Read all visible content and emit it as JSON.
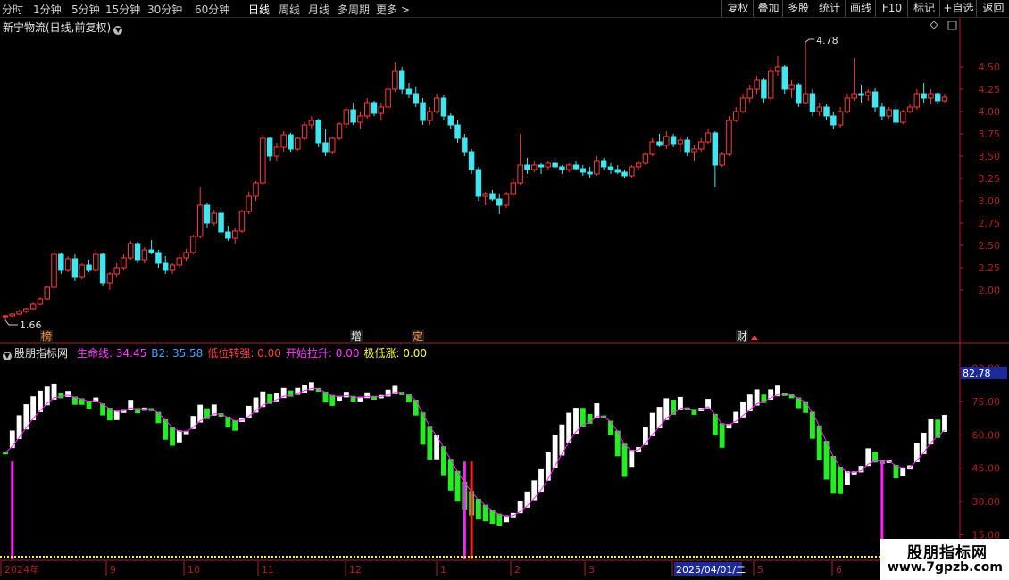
{
  "toolbar": {
    "tabs": [
      "分时",
      "1分钟",
      "5分钟",
      "15分钟",
      "30分钟",
      "60分钟",
      "日线",
      "周线",
      "月线",
      "多周期",
      "更多 >"
    ],
    "active": "日线",
    "right_buttons": [
      "复权",
      "叠加",
      "多股",
      "统计",
      "画线",
      "F10",
      "标记",
      "+自选",
      "返回"
    ]
  },
  "main_chart": {
    "title": "新宁物流(日线,前复权)",
    "price_ticks": [
      "4.50",
      "4.25",
      "4.00",
      "3.75",
      "3.50",
      "3.25",
      "3.00",
      "2.75",
      "2.50",
      "2.25",
      "2.00"
    ],
    "high_label": "4.78",
    "low_label": "1.66",
    "markers": [
      "榜",
      "增",
      "定",
      "财"
    ]
  },
  "indicator": {
    "name": "股朋指标网",
    "fields": [
      {
        "label": "生命线: 34.45",
        "color": "#ff3cff"
      },
      {
        "label": "B2: 35.58",
        "color": "#4aa3ff"
      },
      {
        "label": "低位转强: 0.00",
        "color": "#ff4040"
      },
      {
        "label": "开始拉升: 0.00",
        "color": "#ff3cff"
      },
      {
        "label": "极低涨: 0.00",
        "color": "#ffff40"
      }
    ],
    "ticks": [
      "90.00",
      "75.00",
      "60.00",
      "45.00",
      "30.00",
      "15.00"
    ],
    "current_value": "82.78"
  },
  "time_axis": {
    "labels": [
      "2024年",
      "9",
      "10",
      "11",
      "12",
      "1",
      "2",
      "3",
      "2025/04/01/二",
      "5",
      "6"
    ]
  },
  "watermark": {
    "title": "股朋指标网",
    "url": "www.7gpzb.com"
  },
  "colors": {
    "up": "#ff3c3c",
    "down": "#3fe6f0",
    "green": "#22ee22",
    "white": "#ffffff",
    "magenta": "#ff22ff",
    "red": "#ff2020",
    "yellow": "#ffff00",
    "axis": "#b02020"
  },
  "chart_data": {
    "type": "candlestick",
    "candles": [
      [
        1.7,
        1.72,
        1.66,
        1.71
      ],
      [
        1.71,
        1.74,
        1.7,
        1.73
      ],
      [
        1.73,
        1.78,
        1.72,
        1.76
      ],
      [
        1.76,
        1.8,
        1.74,
        1.79
      ],
      [
        1.79,
        1.86,
        1.78,
        1.84
      ],
      [
        1.84,
        1.92,
        1.83,
        1.9
      ],
      [
        1.9,
        2.05,
        1.89,
        2.03
      ],
      [
        2.03,
        2.45,
        2.02,
        2.4
      ],
      [
        2.4,
        2.42,
        2.18,
        2.22
      ],
      [
        2.22,
        2.38,
        2.2,
        2.35
      ],
      [
        2.35,
        2.4,
        2.1,
        2.15
      ],
      [
        2.15,
        2.3,
        2.12,
        2.28
      ],
      [
        2.28,
        2.34,
        2.2,
        2.22
      ],
      [
        2.22,
        2.45,
        2.2,
        2.4
      ],
      [
        2.4,
        2.42,
        2.05,
        2.08
      ],
      [
        2.08,
        2.2,
        2.0,
        2.18
      ],
      [
        2.18,
        2.3,
        2.15,
        2.25
      ],
      [
        2.25,
        2.4,
        2.22,
        2.36
      ],
      [
        2.36,
        2.55,
        2.34,
        2.52
      ],
      [
        2.52,
        2.54,
        2.3,
        2.34
      ],
      [
        2.34,
        2.48,
        2.3,
        2.45
      ],
      [
        2.45,
        2.56,
        2.4,
        2.42
      ],
      [
        2.42,
        2.45,
        2.25,
        2.3
      ],
      [
        2.3,
        2.38,
        2.18,
        2.22
      ],
      [
        2.22,
        2.3,
        2.18,
        2.28
      ],
      [
        2.28,
        2.4,
        2.25,
        2.36
      ],
      [
        2.36,
        2.46,
        2.32,
        2.42
      ],
      [
        2.42,
        2.62,
        2.4,
        2.6
      ],
      [
        2.6,
        3.15,
        2.58,
        2.95
      ],
      [
        2.95,
        2.98,
        2.7,
        2.75
      ],
      [
        2.75,
        2.9,
        2.72,
        2.86
      ],
      [
        2.86,
        2.92,
        2.6,
        2.65
      ],
      [
        2.65,
        2.72,
        2.55,
        2.58
      ],
      [
        2.58,
        2.7,
        2.52,
        2.66
      ],
      [
        2.66,
        2.9,
        2.64,
        2.88
      ],
      [
        2.88,
        3.1,
        2.85,
        3.05
      ],
      [
        3.05,
        3.22,
        3.0,
        3.2
      ],
      [
        3.2,
        3.75,
        3.18,
        3.7
      ],
      [
        3.7,
        3.72,
        3.45,
        3.5
      ],
      [
        3.5,
        3.65,
        3.45,
        3.6
      ],
      [
        3.6,
        3.78,
        3.55,
        3.74
      ],
      [
        3.74,
        3.76,
        3.55,
        3.58
      ],
      [
        3.58,
        3.72,
        3.56,
        3.7
      ],
      [
        3.7,
        3.88,
        3.68,
        3.85
      ],
      [
        3.85,
        3.95,
        3.8,
        3.9
      ],
      [
        3.9,
        3.92,
        3.6,
        3.65
      ],
      [
        3.65,
        3.8,
        3.5,
        3.55
      ],
      [
        3.55,
        3.72,
        3.52,
        3.7
      ],
      [
        3.7,
        3.88,
        3.68,
        3.86
      ],
      [
        3.86,
        4.05,
        3.82,
        4.02
      ],
      [
        4.02,
        4.1,
        3.85,
        3.88
      ],
      [
        3.88,
        4.0,
        3.8,
        3.95
      ],
      [
        3.95,
        4.15,
        3.92,
        4.1
      ],
      [
        4.1,
        4.12,
        3.95,
        3.98
      ],
      [
        3.98,
        4.1,
        3.9,
        4.05
      ],
      [
        4.05,
        4.3,
        4.02,
        4.25
      ],
      [
        4.25,
        4.55,
        4.22,
        4.45
      ],
      [
        4.45,
        4.5,
        4.2,
        4.25
      ],
      [
        4.25,
        4.32,
        4.15,
        4.2
      ],
      [
        4.2,
        4.28,
        4.05,
        4.1
      ],
      [
        4.1,
        4.15,
        3.85,
        3.9
      ],
      [
        3.9,
        4.05,
        3.85,
        4.0
      ],
      [
        4.0,
        4.2,
        3.98,
        4.15
      ],
      [
        4.15,
        4.18,
        3.9,
        3.95
      ],
      [
        3.95,
        3.98,
        3.8,
        3.85
      ],
      [
        3.85,
        3.9,
        3.65,
        3.7
      ],
      [
        3.7,
        3.75,
        3.5,
        3.55
      ],
      [
        3.55,
        3.58,
        3.3,
        3.35
      ],
      [
        3.35,
        3.38,
        3.0,
        3.05
      ],
      [
        3.05,
        3.1,
        2.95,
        3.08
      ],
      [
        3.08,
        3.12,
        3.0,
        3.02
      ],
      [
        3.02,
        3.08,
        2.85,
        2.95
      ],
      [
        2.95,
        3.1,
        2.92,
        3.08
      ],
      [
        3.08,
        3.25,
        3.05,
        3.2
      ],
      [
        3.2,
        3.75,
        3.18,
        3.4
      ],
      [
        3.4,
        3.48,
        3.3,
        3.35
      ],
      [
        3.35,
        3.45,
        3.32,
        3.4
      ],
      [
        3.4,
        3.42,
        3.3,
        3.38
      ],
      [
        3.38,
        3.45,
        3.35,
        3.42
      ],
      [
        3.42,
        3.48,
        3.36,
        3.38
      ],
      [
        3.38,
        3.4,
        3.3,
        3.35
      ],
      [
        3.35,
        3.42,
        3.32,
        3.4
      ],
      [
        3.4,
        3.45,
        3.34,
        3.36
      ],
      [
        3.36,
        3.4,
        3.28,
        3.32
      ],
      [
        3.32,
        3.38,
        3.26,
        3.3
      ],
      [
        3.3,
        3.5,
        3.28,
        3.45
      ],
      [
        3.45,
        3.48,
        3.35,
        3.38
      ],
      [
        3.38,
        3.42,
        3.3,
        3.35
      ],
      [
        3.35,
        3.4,
        3.3,
        3.32
      ],
      [
        3.32,
        3.35,
        3.25,
        3.28
      ],
      [
        3.28,
        3.4,
        3.26,
        3.38
      ],
      [
        3.38,
        3.45,
        3.35,
        3.42
      ],
      [
        3.42,
        3.55,
        3.4,
        3.52
      ],
      [
        3.52,
        3.7,
        3.5,
        3.66
      ],
      [
        3.66,
        3.75,
        3.6,
        3.62
      ],
      [
        3.62,
        3.78,
        3.58,
        3.72
      ],
      [
        3.72,
        3.75,
        3.6,
        3.64
      ],
      [
        3.64,
        3.72,
        3.55,
        3.68
      ],
      [
        3.68,
        3.72,
        3.5,
        3.55
      ],
      [
        3.55,
        3.62,
        3.45,
        3.58
      ],
      [
        3.58,
        3.7,
        3.55,
        3.66
      ],
      [
        3.66,
        3.8,
        3.64,
        3.76
      ],
      [
        3.76,
        3.78,
        3.15,
        3.4
      ],
      [
        3.4,
        3.55,
        3.38,
        3.52
      ],
      [
        3.52,
        3.95,
        3.5,
        3.9
      ],
      [
        3.9,
        4.05,
        3.88,
        4.0
      ],
      [
        4.0,
        4.2,
        3.98,
        4.15
      ],
      [
        4.15,
        4.3,
        4.1,
        4.25
      ],
      [
        4.25,
        4.4,
        4.2,
        4.35
      ],
      [
        4.35,
        4.38,
        4.1,
        4.15
      ],
      [
        4.15,
        4.5,
        4.12,
        4.45
      ],
      [
        4.45,
        4.62,
        4.4,
        4.5
      ],
      [
        4.5,
        4.52,
        4.2,
        4.25
      ],
      [
        4.25,
        4.35,
        4.15,
        4.3
      ],
      [
        4.3,
        4.32,
        4.05,
        4.1
      ],
      [
        4.1,
        4.78,
        4.08,
        4.2
      ],
      [
        4.2,
        4.25,
        3.95,
        4.0
      ],
      [
        4.0,
        4.1,
        3.95,
        4.05
      ],
      [
        4.05,
        4.08,
        3.9,
        3.95
      ],
      [
        3.95,
        4.0,
        3.8,
        3.85
      ],
      [
        3.85,
        4.05,
        3.82,
        4.0
      ],
      [
        4.0,
        4.2,
        3.98,
        4.15
      ],
      [
        4.15,
        4.6,
        4.12,
        4.2
      ],
      [
        4.2,
        4.3,
        4.1,
        4.18
      ],
      [
        4.18,
        4.25,
        4.12,
        4.22
      ],
      [
        4.22,
        4.26,
        4.0,
        4.05
      ],
      [
        4.05,
        4.1,
        3.9,
        3.95
      ],
      [
        3.95,
        4.05,
        3.92,
        4.02
      ],
      [
        4.02,
        4.1,
        3.85,
        3.88
      ],
      [
        3.88,
        4.02,
        3.86,
        4.0
      ],
      [
        4.0,
        4.08,
        3.98,
        4.05
      ],
      [
        4.05,
        4.25,
        4.02,
        4.2
      ],
      [
        4.2,
        4.32,
        4.1,
        4.15
      ],
      [
        4.15,
        4.25,
        4.08,
        4.2
      ],
      [
        4.2,
        4.22,
        4.08,
        4.12
      ],
      [
        4.12,
        4.2,
        4.1,
        4.16
      ]
    ],
    "indicator_series": {
      "range": [
        10,
        95
      ],
      "life_line_recent": 34.45,
      "b2_recent": 35.58,
      "vertical_signals": [
        {
          "index": 1,
          "color": "magenta",
          "value": 48
        },
        {
          "index": 66,
          "color": "magenta",
          "value": 48
        },
        {
          "index": 67,
          "color": "red",
          "value": 48
        },
        {
          "index": 126,
          "color": "magenta",
          "value": 48
        }
      ]
    }
  }
}
